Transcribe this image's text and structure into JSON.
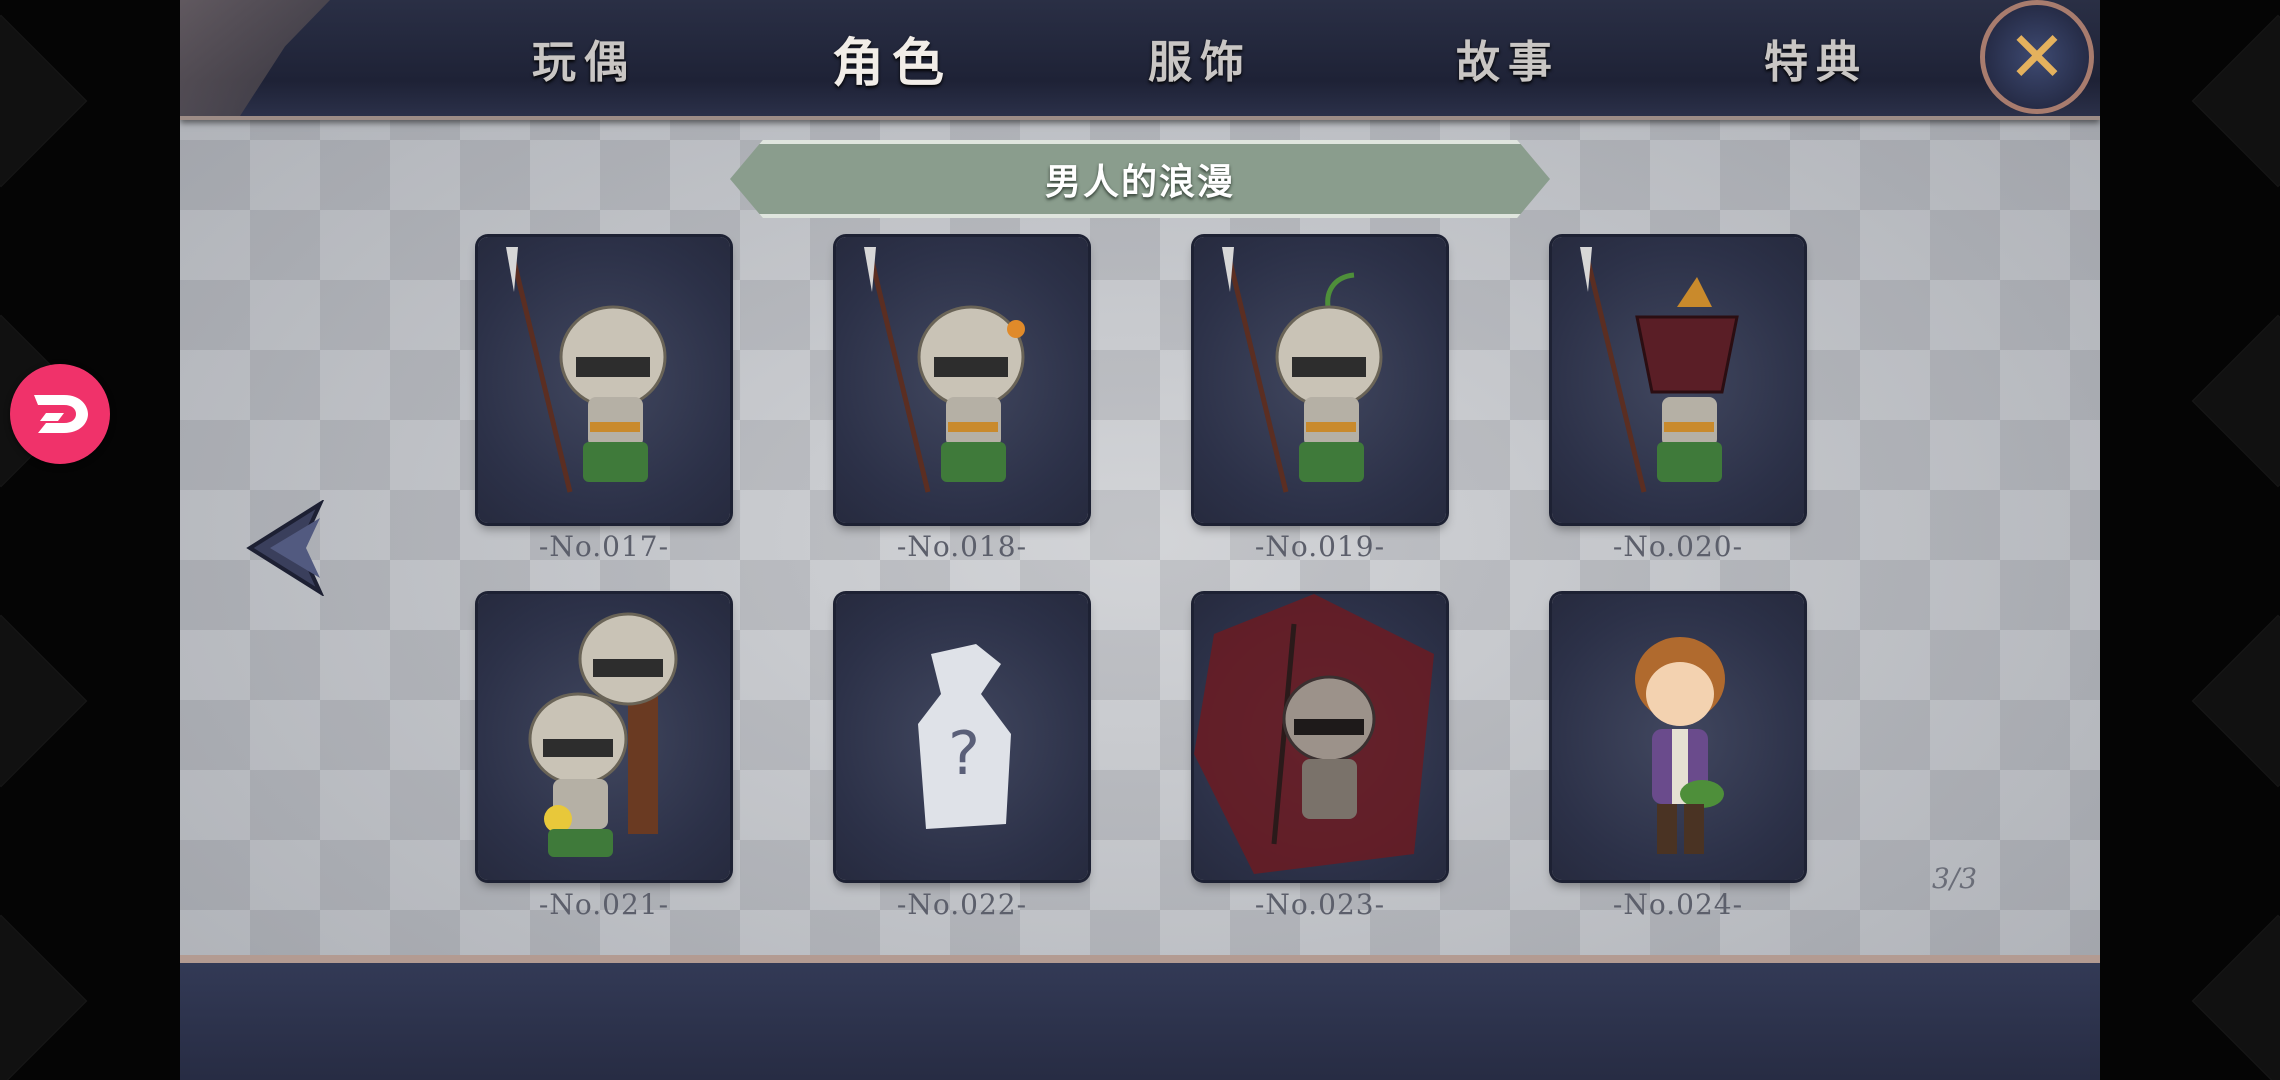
{
  "tabs": [
    {
      "label": "玩偶"
    },
    {
      "label": "角色"
    },
    {
      "label": "服饰"
    },
    {
      "label": "故事"
    },
    {
      "label": "特典"
    }
  ],
  "active_tab": "角色",
  "close_icon": "close-icon",
  "section_title": "男人的浪漫",
  "cards": [
    {
      "label": "-No.017-",
      "state": "unlocked",
      "art": "spear-knight"
    },
    {
      "label": "-No.018-",
      "state": "unlocked",
      "art": "spear-knight-flower"
    },
    {
      "label": "-No.019-",
      "state": "unlocked",
      "art": "spear-knight-sprout"
    },
    {
      "label": "-No.020-",
      "state": "unlocked",
      "art": "spear-knight-pot"
    },
    {
      "label": "-No.021-",
      "state": "unlocked",
      "art": "twin-knights"
    },
    {
      "label": "-No.022-",
      "state": "locked",
      "art": "question-silhouette"
    },
    {
      "label": "-No.023-",
      "state": "unlocked",
      "art": "dark-knight"
    },
    {
      "label": "-No.024-",
      "state": "unlocked",
      "art": "brown-hair-boy"
    }
  ],
  "page_indicator": "3/3",
  "colors": {
    "accent_close": "#e4b15d",
    "banner": "#8a9d8d",
    "overlay_button": "#f0326a"
  }
}
